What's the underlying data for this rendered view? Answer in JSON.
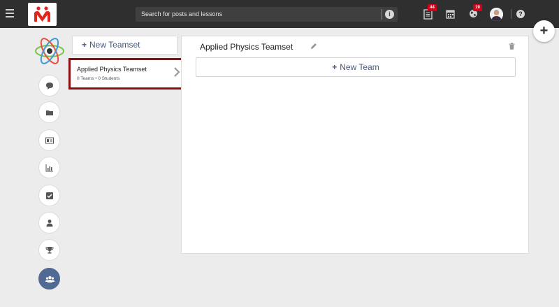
{
  "header": {
    "search_placeholder": "Search for posts and lessons",
    "info_symbol": "i",
    "posts_badge": "44",
    "notifications_badge": "19",
    "help_symbol": "?",
    "fab_symbol": "+"
  },
  "teamsets": {
    "new_button_label": "New Teamset",
    "items": [
      {
        "name": "Applied Physics Teamset",
        "meta": "0 Teams • 0 Students"
      }
    ]
  },
  "panel": {
    "title": "Applied Physics Teamset",
    "new_team_label": "New Team"
  },
  "sidebar": {
    "icons": [
      "chat-icon",
      "folder-icon",
      "id-card-icon",
      "chart-icon",
      "checkbox-icon",
      "user-icon",
      "trophy-icon",
      "group-icon"
    ]
  },
  "colors": {
    "topbar": "#2f2f2f",
    "badge": "#d0021b",
    "active_rail": "#516a94",
    "selection_border": "#8b0d0d",
    "brand": "#e1261c"
  }
}
